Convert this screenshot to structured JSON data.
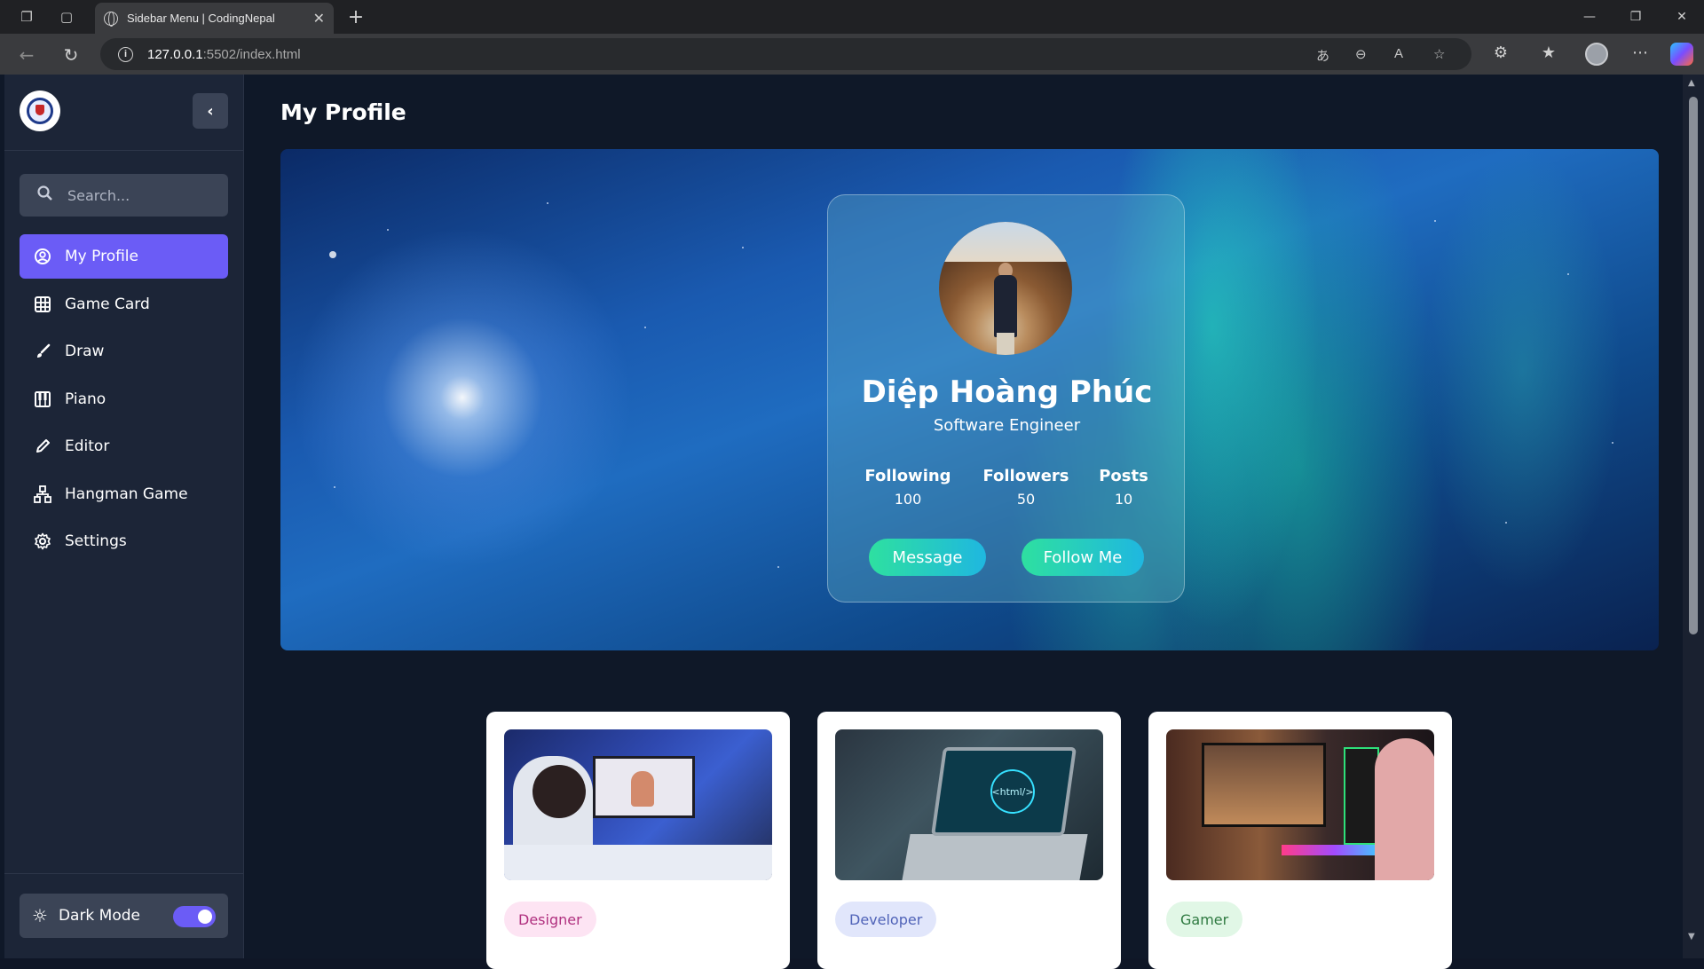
{
  "browser": {
    "tab_title": "Sidebar Menu | CodingNepal",
    "url_host": "127.0.0.1",
    "url_path": ":5502/index.html"
  },
  "sidebar": {
    "search_placeholder": "Search...",
    "items": [
      {
        "label": "My Profile",
        "icon": "profile-icon"
      },
      {
        "label": "Game Card",
        "icon": "grid-icon"
      },
      {
        "label": "Draw",
        "icon": "brush-icon"
      },
      {
        "label": "Piano",
        "icon": "piano-icon"
      },
      {
        "label": "Editor",
        "icon": "pen-icon"
      },
      {
        "label": "Hangman Game",
        "icon": "network-icon"
      },
      {
        "label": "Settings",
        "icon": "gear-icon"
      }
    ],
    "dark_mode_label": "Dark Mode",
    "dark_mode_on": true
  },
  "main": {
    "title": "My Profile",
    "profile": {
      "name": "Diệp Hoàng Phúc",
      "role": "Software Engineer",
      "stats": [
        {
          "label": "Following",
          "value": "100"
        },
        {
          "label": "Followers",
          "value": "50"
        },
        {
          "label": "Posts",
          "value": "10"
        }
      ],
      "message_label": "Message",
      "follow_label": "Follow Me"
    },
    "cards": [
      {
        "tag": "Designer"
      },
      {
        "tag": "Developer"
      },
      {
        "tag": "Gamer"
      }
    ]
  },
  "colors": {
    "accent": "#6b5cf6",
    "sidebar_bg": "#1c2537",
    "page_bg": "#0f1828",
    "button_gradient_start": "#2ee0a0",
    "button_gradient_end": "#1fb7e0"
  }
}
